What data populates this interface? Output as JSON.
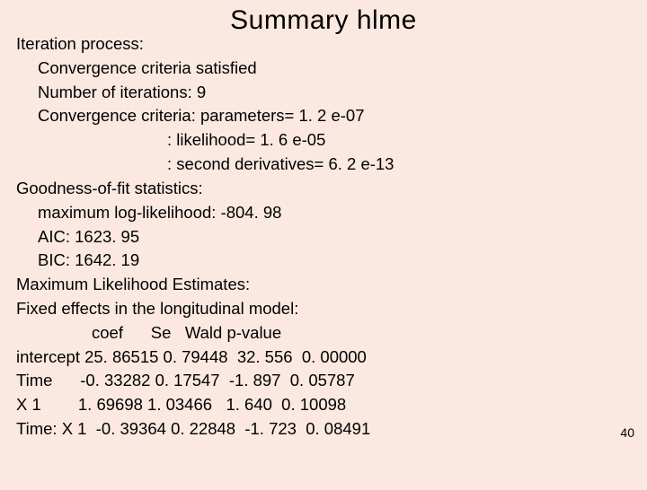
{
  "title": "Summary hlme",
  "page_number": "40",
  "sections": {
    "iteration_label": "Iteration process:",
    "conv_sat": "Convergence criteria satisfied",
    "num_iter": "Number of iterations:  9",
    "crit_params": "Convergence criteria: parameters= 1. 2 e-07",
    "crit_like": ": likelihood= 1. 6 e-05",
    "crit_second": ": second derivatives= 6. 2 e-13",
    "gof_label": "Goodness-of-fit statistics:",
    "max_ll": "maximum log-likelihood: -804. 98",
    "aic": "AIC: 1623. 95",
    "bic": "BIC: 1642. 19",
    "mle_label": "Maximum Likelihood Estimates:",
    "fe_label": "Fixed effects in the longitudinal model:",
    "fe_header": "coef      Se   Wald p-value",
    "rows": {
      "intercept": "intercept 25. 86515 0. 79448  32. 556  0. 00000",
      "time": "Time      -0. 33282 0. 17547  -1. 897  0. 05787",
      "x1": "X 1        1. 69698 1. 03466   1. 640  0. 10098",
      "timex1": "Time: X 1  -0. 39364 0. 22848  -1. 723  0. 08491"
    }
  }
}
